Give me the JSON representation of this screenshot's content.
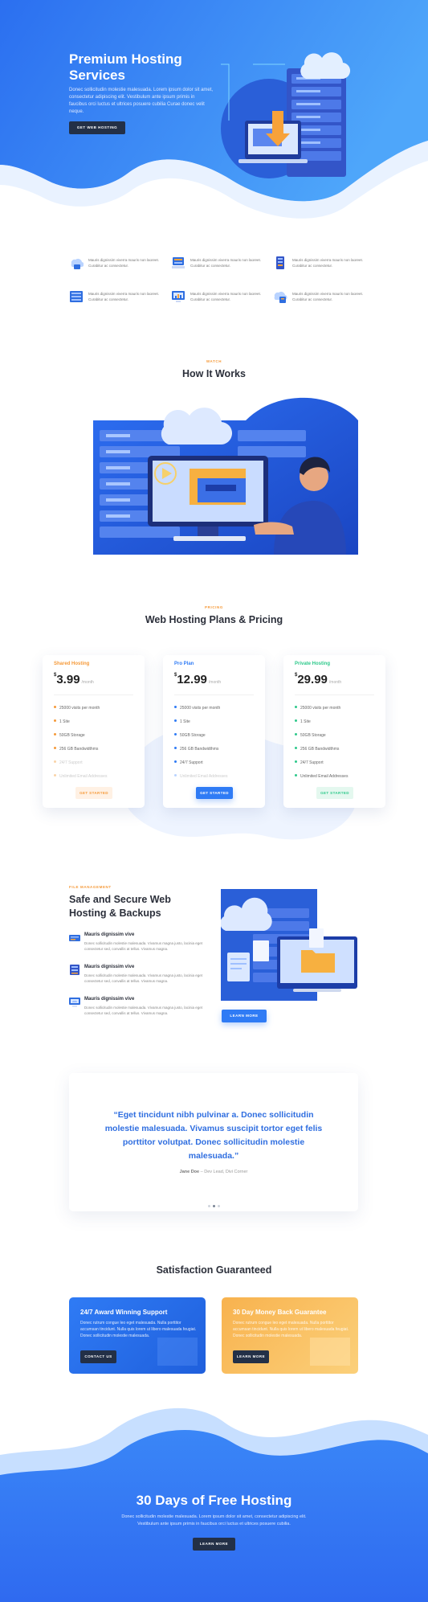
{
  "hero": {
    "title": "Premium Hosting Services",
    "text": "Donec sollicitudin molestie malesuada. Lorem ipsum dolor sit amet, consectetur adipiscing elit. Vestibulum ante ipsum primis in faucibus orci luctus et ultrices posuere cubilia Curae donec velit neque.",
    "button": "GET WEB HOSTING"
  },
  "features": [
    {
      "icon": "cloud-storage-icon",
      "text": "Mauris dignissim viverra mauris non laoreet. Curabitur ac consectetur."
    },
    {
      "icon": "server-stack-icon",
      "text": "Mauris dignissim viverra mauris non laoreet. Curabitur ac consectetur."
    },
    {
      "icon": "server-rack-icon",
      "text": "Mauris dignissim viverra mauris non laoreet. Curabitur ac consectetur."
    },
    {
      "icon": "database-icon",
      "text": "Mauris dignissim viverra mauris non laoreet. Curabitur ac consectetur."
    },
    {
      "icon": "monitor-chart-icon",
      "text": "Mauris dignissim viverra mauris non laoreet. Curabitur ac consectetur."
    },
    {
      "icon": "cloud-upload-icon",
      "text": "Mauris dignissim viverra mauris non laoreet. Curabitur ac consectetur."
    }
  ],
  "how": {
    "eyebrow": "WATCH",
    "title": "How It Works"
  },
  "pricing": {
    "eyebrow": "PRICING",
    "title": "Web Hosting Plans & Pricing",
    "plans": [
      {
        "name": "Shared Hosting",
        "currency": "$",
        "price": "3.99",
        "per": "/month",
        "accent": "#f59a3a",
        "features": [
          "25000 visits per month",
          "1 Site",
          "50GB Storage",
          "256 GB Bandwidthms",
          "24/7 Support",
          "Unlimited Email Addresses"
        ],
        "enabled": [
          true,
          true,
          true,
          true,
          false,
          false
        ],
        "button": "GET STARTED"
      },
      {
        "name": "Pro Plan",
        "currency": "$",
        "price": "12.99",
        "per": "/month",
        "accent": "#2f7bf5",
        "features": [
          "25000 visits per month",
          "1 Site",
          "50GB Storage",
          "256 GB Bandwidthms",
          "24/7 Support",
          "Unlimited Email Addresses"
        ],
        "enabled": [
          true,
          true,
          true,
          true,
          true,
          false
        ],
        "button": "GET STARTED"
      },
      {
        "name": "Private Hosting",
        "currency": "$",
        "price": "29.99",
        "per": "/month",
        "accent": "#2ec98b",
        "features": [
          "25000 visits per month",
          "1 Site",
          "50GB Storage",
          "256 GB Bandwidthms",
          "24/7 Support",
          "Unlimited Email Addresses"
        ],
        "enabled": [
          true,
          true,
          true,
          true,
          true,
          true
        ],
        "button": "GET STARTED"
      }
    ]
  },
  "file_mgmt": {
    "eyebrow": "FILE MANAGEMENT",
    "title": "Safe and Secure Web Hosting & Backups",
    "items": [
      {
        "icon": "storage-drive-icon",
        "title": "Mauris dignissim vive",
        "text": "Donec sollicitudin molestie malesuada. Vivamus magna justo, lacinia eget consectetur sed, convallis at tellus. Vivamus magna."
      },
      {
        "icon": "server-rack-icon",
        "title": "Mauris dignissim vive",
        "text": "Donec sollicitudin molestie malesuada. Vivamus magna justo, lacinia eget consectetur sed, convallis at tellus. Vivamus magna."
      },
      {
        "icon": "monitor-cloud-icon",
        "title": "Mauris dignissim vive",
        "text": "Donec sollicitudin molestie malesuada. Vivamus magna justo, lacinia eget consectetur sed, convallis at tellus. Vivamus magna."
      }
    ],
    "button": "LEARN MORE"
  },
  "testimonial": {
    "quote": "“Eget tincidunt nibh pulvinar a. Donec sollicitudin molestie malesuada. Vivamus suscipit tortor eget felis porttitor volutpat. Donec sollicitudin molestie malesuada.”",
    "name": "Jane Doe",
    "role": " – Dev Lead, Divi Corner"
  },
  "guarantee": {
    "title": "Satisfaction Guaranteed",
    "boxes": [
      {
        "title": "24/7 Award Winning Support",
        "text": "Donec rutrum congue leo eget malesuada. Nulla porttitor accumsan tincidunt. Nulla quis lorem ut libero malesuada feugiat. Donec sollicitudin molestie malesuada.",
        "button": "CONTACT US"
      },
      {
        "title": "30 Day Money Back Guarantee",
        "text": "Donec rutrum congue leo eget malesuada. Nulla porttitor accumsan tincidunt. Nulla quis lorem ut libero malesuada feugiat. Donec sollicitudin molestie malesuada.",
        "button": "LEARN MORE"
      }
    ]
  },
  "cta": {
    "title": "30 Days of Free Hosting",
    "text": "Donec sollicitudin molestie malesuada. Lorem ipsum dolor sit amet, consectetur adipiscing elit. Vestibulum ante ipsum primis in faucibus orci luctus et ultrices posuere cubilia.",
    "button": "LEARN MORE"
  },
  "colors": {
    "primary": "#2f7bf5",
    "dark": "#233047",
    "orange": "#f59a3a",
    "green": "#2ec98b"
  }
}
